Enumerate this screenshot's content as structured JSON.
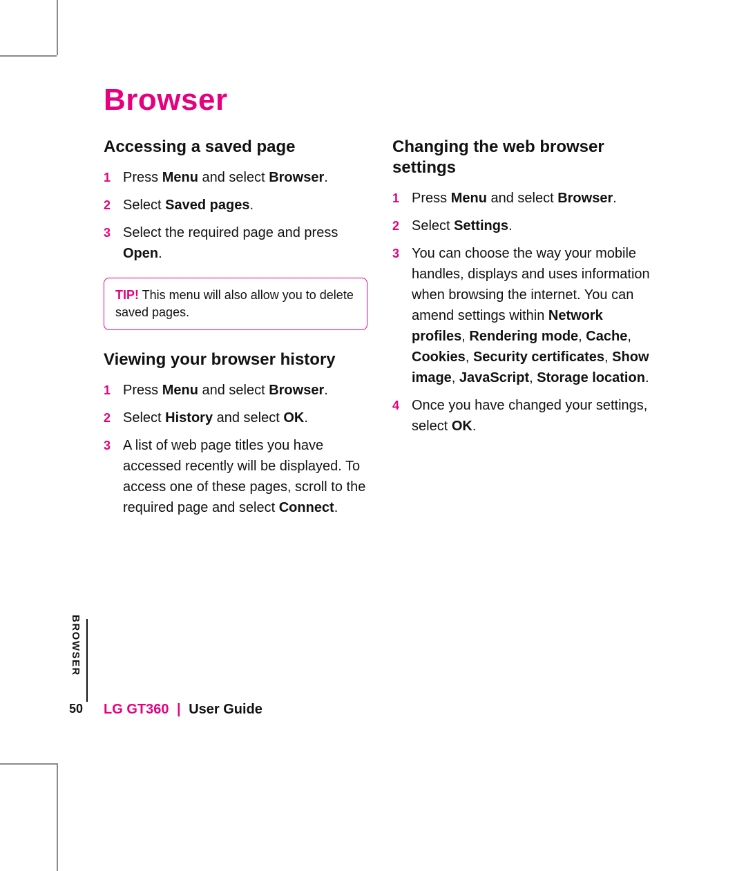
{
  "title": "Browser",
  "sideLabel": "BROWSER",
  "pageNumber": "50",
  "footer": {
    "brand": "LG GT360",
    "separator": "|",
    "guide": "User Guide"
  },
  "left": {
    "section1": {
      "heading": "Accessing a saved page",
      "steps": [
        {
          "num": "1",
          "html": "Press <b>Menu</b> and select <b>Browser</b>."
        },
        {
          "num": "2",
          "html": "Select <b>Saved pages</b>."
        },
        {
          "num": "3",
          "html": "Select the required page and press <b>Open</b>."
        }
      ],
      "tip": {
        "label": "TIP!",
        "text": " This menu will also allow you to delete saved pages."
      }
    },
    "section2": {
      "heading": "Viewing your browser history",
      "steps": [
        {
          "num": "1",
          "html": "Press <b>Menu</b> and select <b>Browser</b>."
        },
        {
          "num": "2",
          "html": "Select <b>History</b> and select <b>OK</b>."
        },
        {
          "num": "3",
          "html": "A list of web page titles you have accessed recently will be displayed. To access one of these pages, scroll to the required page and select <b>Connect</b>."
        }
      ]
    }
  },
  "right": {
    "section1": {
      "heading": "Changing the web browser settings",
      "steps": [
        {
          "num": "1",
          "html": "Press <b>Menu</b> and select <b>Browser</b>."
        },
        {
          "num": "2",
          "html": "Select <b>Settings</b>."
        },
        {
          "num": "3",
          "html": "You can choose the way your mobile handles, displays and uses information when browsing the internet. You can amend settings within <b>Network profiles</b>, <b>Rendering mode</b>, <b>Cache</b>, <b>Cookies</b>, <b>Security certificates</b>, <b>Show image</b>, <b>JavaScript</b>, <b>Storage location</b>."
        },
        {
          "num": "4",
          "html": "Once you have changed your settings, select <b>OK</b>."
        }
      ]
    }
  }
}
